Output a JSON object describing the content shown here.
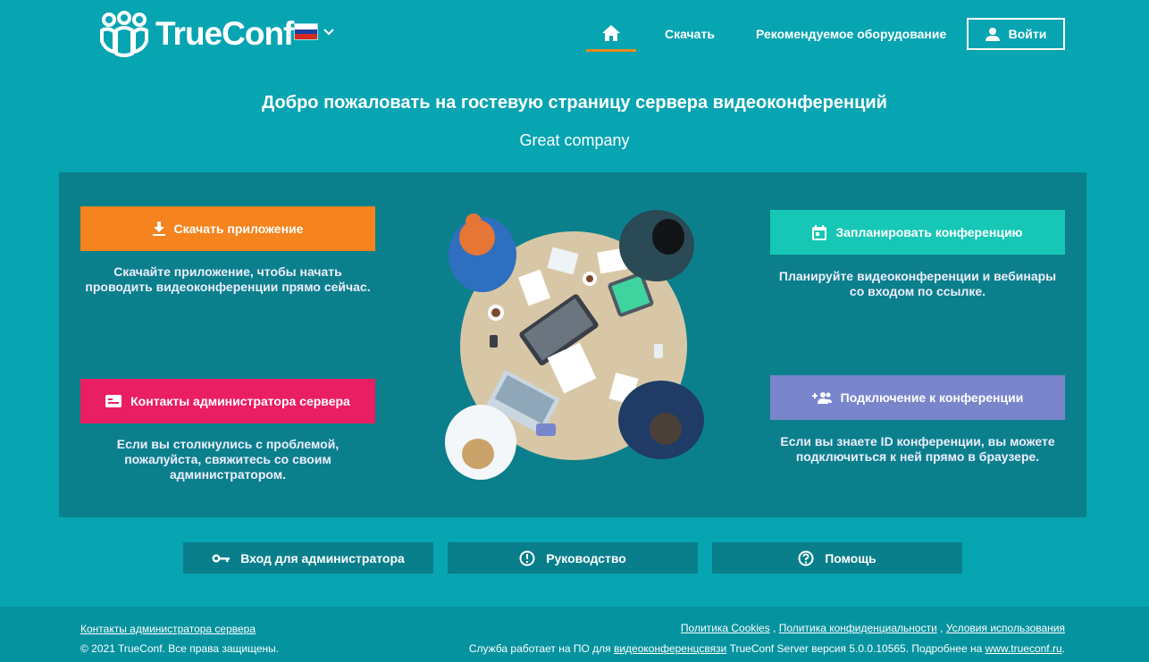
{
  "header": {
    "logo_text": "TrueConf",
    "language_flag": [
      "#ffffff",
      "#1c3f9e",
      "#d52b1e"
    ],
    "nav": {
      "download": "Скачать",
      "equipment": "Рекомендуемое оборудование"
    },
    "login_label": "Войти"
  },
  "hero": {
    "title": "Добро пожаловать на гостевую страницу сервера видеоконференций",
    "subtitle": "Great company"
  },
  "actions": {
    "download": {
      "label": "Скачать приложение",
      "description": "Скачайте приложение, чтобы начать проводить видеоконференции прямо сейчас.",
      "color": "#f5831e"
    },
    "contacts": {
      "label": "Контакты администратора сервера",
      "description": "Если вы столкнулись с проблемой, пожалуйста, свяжитесь со своим администратором.",
      "color": "#ea1e63"
    },
    "plan": {
      "label": "Запланировать конференцию",
      "description": "Планируйте видеоконференции и вебинары со входом по ссылке.",
      "color": "#17c7b6"
    },
    "join": {
      "label": "Подключение к конференции",
      "description": "Если вы знаете ID конференции, вы можете подключиться к ней прямо в браузере.",
      "color": "#7a86cc"
    }
  },
  "links": {
    "admin_login": "Вход для администратора",
    "guide": "Руководство",
    "help": "Помощь"
  },
  "footer": {
    "admin_contacts": "Контакты администратора сервера",
    "copyright": "© 2021 TrueConf. Все права защищены.",
    "cookies": "Политика Cookies",
    "privacy": "Политика конфиденциальности",
    "terms": "Условия использования",
    "sep1": " , ",
    "sep2": " , ",
    "service_prefix": "Служба работает на ПО для ",
    "videoconf_link": "видеоконференцсвязи",
    "service_mid": " TrueConf Server версия 5.0.0.10565. Подробнее на ",
    "site_link": "www.trueconf.ru",
    "service_end": "."
  },
  "colors": {
    "background": "#07a4b2",
    "panel": "#0b808c",
    "accent_underline": "#f5891f"
  }
}
